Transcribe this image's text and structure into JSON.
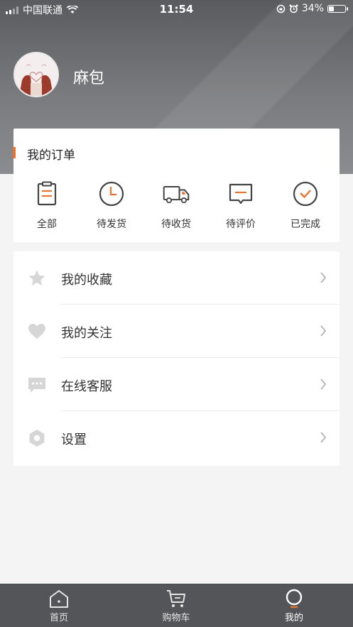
{
  "status_bar": {
    "carrier": "中国联通",
    "time": "11:54",
    "battery": "34%",
    "battery_level": 0.34
  },
  "profile": {
    "username": "麻包"
  },
  "orders": {
    "title": "我的订单",
    "accent_color": "#e8742f",
    "items": [
      {
        "label": "全部",
        "icon": "clipboard-icon"
      },
      {
        "label": "待发货",
        "icon": "clock-icon"
      },
      {
        "label": "待收货",
        "icon": "truck-icon"
      },
      {
        "label": "待评价",
        "icon": "comment-icon"
      },
      {
        "label": "已完成",
        "icon": "check-circle-icon"
      }
    ]
  },
  "menu": {
    "items": [
      {
        "label": "我的收藏",
        "icon": "star-icon"
      },
      {
        "label": "我的关注",
        "icon": "heart-icon"
      },
      {
        "label": "在线客服",
        "icon": "chat-icon"
      },
      {
        "label": "设置",
        "icon": "settings-hexagon-icon"
      }
    ]
  },
  "tab_bar": {
    "tabs": [
      {
        "label": "首页",
        "icon": "home-icon"
      },
      {
        "label": "购物车",
        "icon": "cart-icon"
      },
      {
        "label": "我的",
        "icon": "profile-circle-icon",
        "active": true
      }
    ]
  }
}
